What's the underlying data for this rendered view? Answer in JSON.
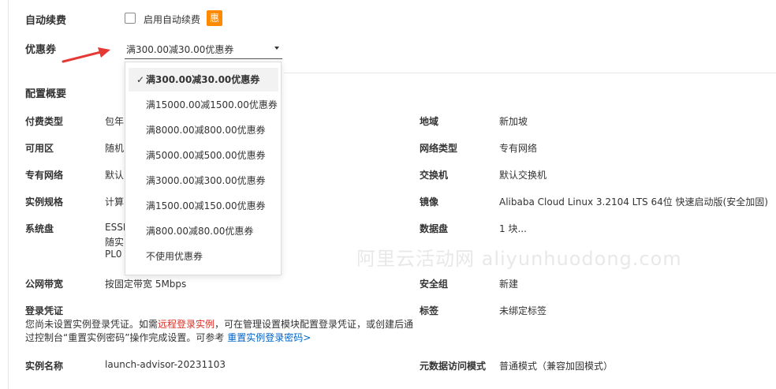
{
  "auto_renew": {
    "label": "自动续费",
    "checkbox_label": "启用自动续费",
    "badge": "惠",
    "checked": false
  },
  "coupon": {
    "label": "优惠券",
    "selected": "满300.00减30.00优惠券",
    "options": [
      {
        "label": "满300.00减30.00优惠券",
        "selected": true
      },
      {
        "label": "满15000.00减1500.00优惠券",
        "selected": false
      },
      {
        "label": "满8000.00减800.00优惠券",
        "selected": false
      },
      {
        "label": "满5000.00减500.00优惠券",
        "selected": false
      },
      {
        "label": "满3000.00减300.00优惠券",
        "selected": false
      },
      {
        "label": "满1500.00减150.00优惠券",
        "selected": false
      },
      {
        "label": "满800.00减80.00优惠券",
        "selected": false
      },
      {
        "label": "不使用优惠券",
        "selected": false
      }
    ],
    "check_mark": "✓"
  },
  "config_overview": {
    "title": "配置概要",
    "billing_type": {
      "label": "付费类型",
      "value": "包年"
    },
    "zone": {
      "label": "可用区",
      "value": "随机"
    },
    "vpc": {
      "label": "专有网络",
      "value": "默认"
    },
    "instance_type": {
      "label": "实例规格",
      "value": "计算"
    },
    "system_disk": {
      "label": "系统盘",
      "value_lines": [
        "ESSD",
        "随实",
        "PL0"
      ]
    },
    "public_bandwidth": {
      "label": "公网带宽",
      "value": "按固定带宽 5Mbps"
    },
    "login_credential": {
      "label": "登录凭证",
      "desc_part1": "您尚未设置实例登录凭证。如需",
      "desc_link1": "远程登录实例",
      "desc_part2": "，可在管理设置模块配置登录凭证，或创建后通过控制台“重置实例密码”操作完成设置。可参考",
      "desc_link2": "重置实例登录密码>"
    },
    "instance_name": {
      "label": "实例名称",
      "value": "launch-advisor-20231103"
    },
    "region": {
      "label": "地域",
      "value": "新加坡"
    },
    "network_type": {
      "label": "网络类型",
      "value": "专有网络"
    },
    "vswitch": {
      "label": "交换机",
      "value": "默认交换机"
    },
    "image": {
      "label": "镜像",
      "value": "Alibaba Cloud Linux 3.2104 LTS 64位 快速启动版(安全加固)"
    },
    "data_disk": {
      "label": "数据盘",
      "value": "1 块..."
    },
    "security_group": {
      "label": "安全组",
      "value": "新建"
    },
    "tags": {
      "label": "标签",
      "value": "未绑定标签"
    },
    "metadata_access": {
      "label": "元数据访问模式",
      "value": "普通模式（兼容加固模式）"
    }
  },
  "watermark": "阿里云活动网 aliyunhuodong.com",
  "colors": {
    "badge": "#ff8a00",
    "arrow": "#e53935",
    "link_red": "#d93026",
    "link_blue": "#0064c8"
  }
}
